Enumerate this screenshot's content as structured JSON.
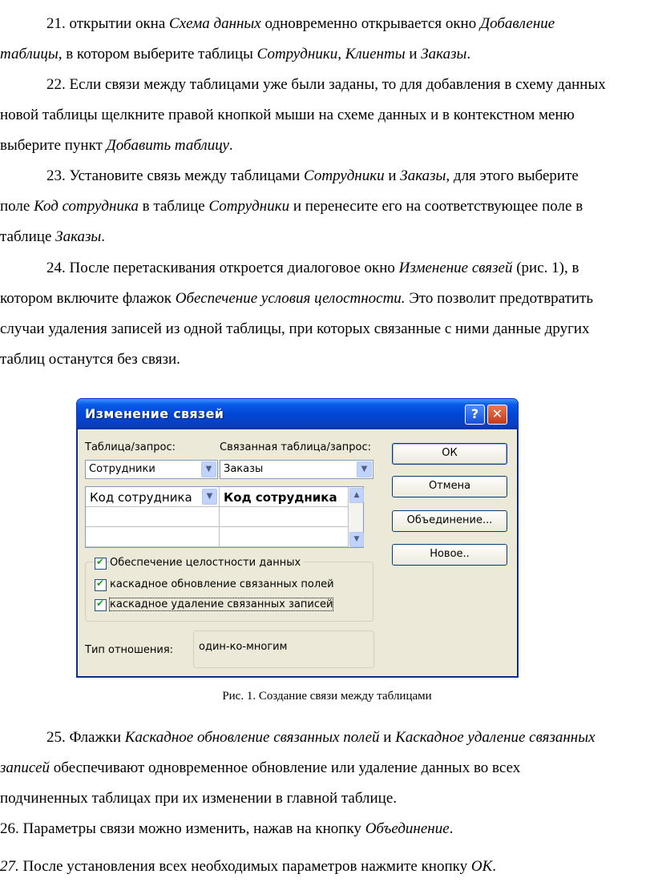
{
  "para21": {
    "l1a": "21. открытии окна ",
    "l1b": "Схема данных",
    "l1c": " одновременно открывается окно ",
    "l1d": "Добавление",
    "l2a": "таблицы,",
    "l2b": " в котором выберите таблицы ",
    "l2c": "Сотрудники, Клиенты",
    "l2d": " и ",
    "l2e": "Заказы",
    "l2f": "."
  },
  "para22": {
    "l1": "22. Если связи между таблицами уже были заданы, то для добавления в схему данных",
    "l2": "новой таблицы щелкните правой кнопкой мыши на схеме данных и в контекстном меню",
    "l3a": "выберите пункт ",
    "l3b": "Добавить таблицу",
    "l3c": "."
  },
  "para23": {
    "l1a": "23. Установите связь между таблицами ",
    "l1b": "Сотрудники",
    "l1c": " и ",
    "l1d": "Заказы,",
    "l1e": " для этого выберите",
    "l2a": "поле ",
    "l2b": "Код сотрудника",
    "l2c": " в таблице ",
    "l2d": "Сотрудники",
    "l2e": " и перенесите его на соответствующее поле в",
    "l3a": "таблице ",
    "l3b": "Заказы",
    "l3c": "."
  },
  "para24": {
    "l1a": "24. После перетаскивания откроется диалоговое окно ",
    "l1b": "Изменение связей",
    "l1c": " (рис. 1), в",
    "l2a": "котором включите флажок ",
    "l2b": "Обеспечение условия целостности.",
    "l2c": " Это позволит предотвратить",
    "l3": "случаи удаления записей из одной таблицы, при которых связанные с ними данные других",
    "l4": "таблиц останутся без связи."
  },
  "dialog": {
    "title": "Изменение связей",
    "help": "?",
    "close": "✕",
    "table_label": "Таблица/запрос:",
    "related_label": "Связанная таблица/запрос:",
    "table_value": "Сотрудники",
    "related_value": "Заказы",
    "field_left": "Код сотрудника",
    "field_right": "Код сотрудника",
    "chk_integrity": "Обеспечение целостности данных",
    "chk_cascade_update": "каскадное обновление связанных полей",
    "chk_cascade_delete": "каскадное удаление связанных записей",
    "rel_type_label": "Тип отношения:",
    "rel_type_value": "один-ко-многим",
    "btn_ok": "ОК",
    "btn_cancel": "Отмена",
    "btn_join": "Объединение...",
    "btn_new": "Новое.."
  },
  "caption": "Рис. 1. Создание связи между таблицами",
  "para25": {
    "l1a": "25. Флажки ",
    "l1b": "Каскадное обновление связанных полей",
    "l1c": " и ",
    "l1d": "Каскадное удаление связанных",
    "l2a": "записей",
    "l2b": " обеспечивают одновременное обновление или удаление данных во всех",
    "l3": "подчиненных таблицах при их изменении в главной таблице."
  },
  "para26": {
    "a": "26. Параметры связи можно изменить, нажав на кнопку ",
    "b": "Объединение",
    "c": "."
  },
  "para27": {
    "a": "27.",
    "b": " После установления всех необходимых параметров нажмите кнопку ",
    "c": "ОК",
    "d": "."
  }
}
